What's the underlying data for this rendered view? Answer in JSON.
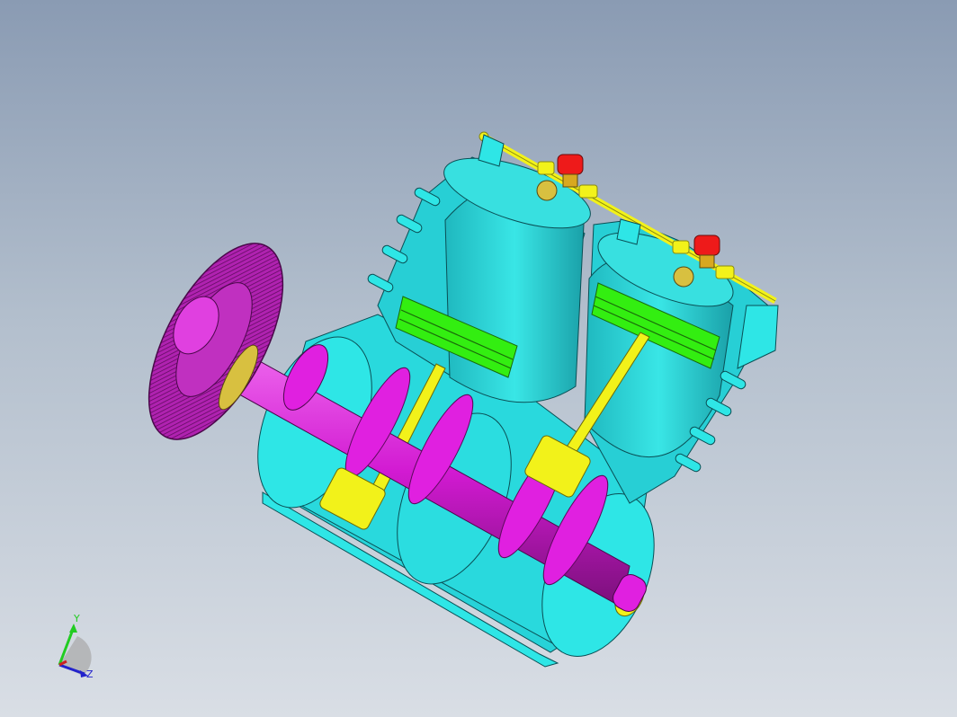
{
  "viewport": {
    "background_top": "#8a9bb3",
    "background_bottom": "#d9dee5"
  },
  "model": {
    "colors": {
      "casing": "#2ee6e6",
      "casing_dark": "#1aa9b0",
      "cylinder": "#34d8d8",
      "piston_ring": "#33ee11",
      "crank": "#e020e0",
      "crank_dark": "#8a108a",
      "con_rod": "#f2f21a",
      "valve": "#ee1a1a",
      "gear": "#b020b0"
    }
  },
  "triad": {
    "y_label": "Y",
    "z_label": "Z",
    "y_color": "#22cc22",
    "z_color": "#2222cc",
    "x_color": "#cc2222"
  }
}
